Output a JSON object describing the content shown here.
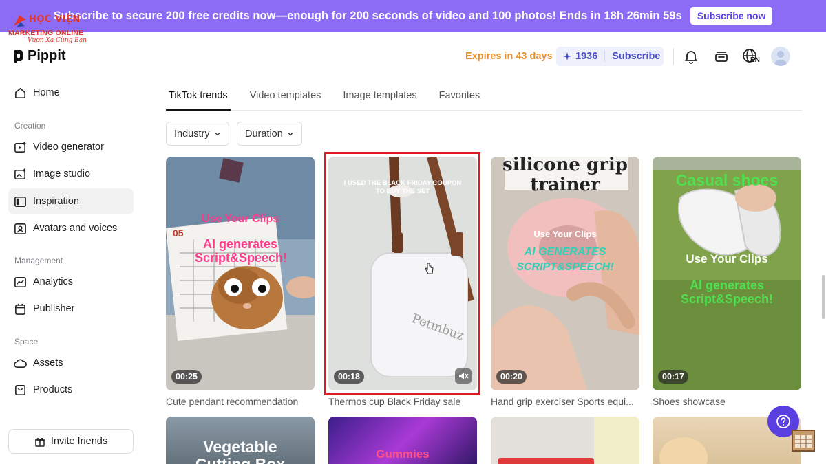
{
  "banner": {
    "text": "Subscribe to secure 200 free credits now—enough for 200 seconds of video and 100 photos! Ends in 18h 26min 59s",
    "button": "Subscribe now"
  },
  "watermark": {
    "line1": "HỌC VIỆN",
    "line2": "MARKETING ONLINE",
    "line3": "Vươn Xa Cùng Bạn"
  },
  "header": {
    "brand": "Pippit",
    "expires": "Expires in 43 days",
    "credits": "1936",
    "subscribe": "Subscribe",
    "lang": "EN"
  },
  "sidebar": {
    "home": "Home",
    "sections": {
      "creation": "Creation",
      "management": "Management",
      "space": "Space"
    },
    "items": {
      "video_generator": "Video generator",
      "image_studio": "Image studio",
      "inspiration": "Inspiration",
      "avatars": "Avatars and voices",
      "analytics": "Analytics",
      "publisher": "Publisher",
      "assets": "Assets",
      "products": "Products"
    },
    "invite": "Invite friends"
  },
  "tabs": [
    "TikTok trends",
    "Video templates",
    "Image templates",
    "Favorites"
  ],
  "filters": {
    "industry": "Industry",
    "duration": "Duration"
  },
  "cards": [
    {
      "caption": "Cute pendant recommendation",
      "duration": "00:25",
      "overlay1": "Use Your Clips",
      "overlay2": "AI generates Script&Speech!",
      "small": "05"
    },
    {
      "caption": "Thermos cup Black Friday sale",
      "duration": "00:18",
      "overlay1": "I USED THE BLACK FRIDAY COUPON",
      "overlay2": "TO BUY THE SET"
    },
    {
      "caption": "Hand grip exerciser Sports equi...",
      "duration": "00:20",
      "overlay1": "silicone grip trainer",
      "overlay2": "Use Your Clips",
      "overlay3": "AI GENERATES SCRIPT&SPEECH!"
    },
    {
      "caption": "Shoes showcase",
      "duration": "00:17",
      "overlay1": "Casual shoes",
      "overlay2": "Use Your Clips",
      "overlay3": "AI generates Script&Speech!"
    }
  ],
  "row2": {
    "card1": "Vegetable Cutting Box",
    "card2": "Gummies"
  },
  "colors": {
    "banner": "#8c6cf5",
    "accent": "#5a3fe0",
    "expires": "#e8912a",
    "highlight": "#e01a24"
  }
}
